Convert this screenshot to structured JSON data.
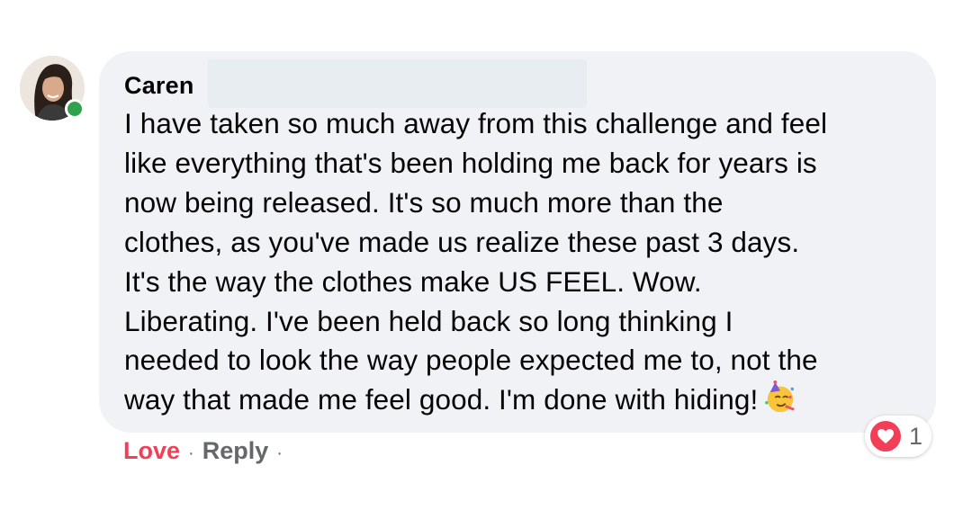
{
  "comment": {
    "author": "Caren",
    "text_lines": [
      "I have taken so much away from this challenge and feel",
      "like everything that's been holding me back for years is",
      "now being released. It's so much more than the",
      "clothes, as you've made us realize these past 3 days.",
      "It's the way the clothes make US FEEL. Wow.",
      "Liberating. I've been held back so long thinking I",
      "needed to look the way people expected me to, not the",
      "way that made me feel good. I'm done with hiding!"
    ],
    "trailing_emoji": "partying-face-icon"
  },
  "reactions": {
    "icon": "heart-icon",
    "count": "1"
  },
  "actions": {
    "love_label": "Love",
    "reply_label": "Reply",
    "separator": "·"
  },
  "colors": {
    "bubble_bg": "#f0f2f5",
    "love_red": "#f33e58",
    "meta_gray": "#65676b",
    "presence_green": "#31a24c"
  }
}
